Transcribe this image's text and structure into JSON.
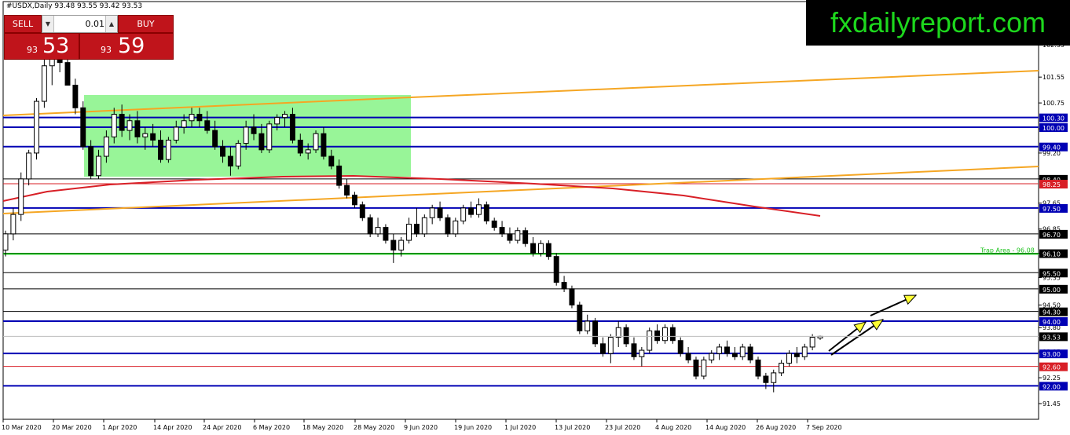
{
  "header": {
    "symbol_info": "#USDX,Daily  93.48 93.55 93.42 93.53"
  },
  "trade_panel": {
    "sell_label": "SELL",
    "buy_label": "BUY",
    "lot_value": "0.01",
    "sell_small": "93",
    "sell_big": "53",
    "buy_small": "93",
    "buy_big": "59"
  },
  "brand": "fxdailyreport.com",
  "colors": {
    "sell_red": "#c0141b",
    "brand_bg": "#000000",
    "brand_text": "#1dd81d",
    "zone_green": "#98f598",
    "ma_red": "#d81f26",
    "trend_orange": "#f5a623",
    "level_blue": "#0000b4"
  },
  "chart_data": {
    "type": "candlestick",
    "symbol": "#USDX",
    "timeframe": "Daily",
    "ylim": [
      91.45,
      102.55
    ],
    "x_labels": [
      "10 Mar 2020",
      "20 Mar 2020",
      "1 Apr 2020",
      "14 Apr 2020",
      "24 Apr 2020",
      "6 May 2020",
      "18 May 2020",
      "28 May 2020",
      "9 Jun 2020",
      "19 Jun 2020",
      "1 Jul 2020",
      "13 Jul 2020",
      "23 Jul 2020",
      "4 Aug 2020",
      "14 Aug 2020",
      "26 Aug 2020",
      "7 Sep 2020"
    ],
    "axis_ticks": [
      102.55,
      101.55,
      100.75,
      99.95,
      99.2,
      98.4,
      97.65,
      96.85,
      96.1,
      95.35,
      94.5,
      93.8,
      93.05,
      92.25,
      91.45
    ],
    "levels": [
      {
        "label": "100.30",
        "value": 100.3,
        "color": "#0000b4"
      },
      {
        "label": "100.00",
        "value": 100.0,
        "color": "#0000b4"
      },
      {
        "label": "99.40",
        "value": 99.4,
        "color": "#0000b4"
      },
      {
        "label": "98.40",
        "value": 98.4,
        "color": "#000000"
      },
      {
        "label": "98.25",
        "value": 98.25,
        "color": "#d81f26"
      },
      {
        "label": "97.50",
        "value": 97.5,
        "color": "#0000b4"
      },
      {
        "label": "96.70",
        "value": 96.7,
        "color": "#000000"
      },
      {
        "label": "96.10",
        "value": 96.1,
        "color": "#000000"
      },
      {
        "label": "95.50",
        "value": 95.5,
        "color": "#000000"
      },
      {
        "label": "95.00",
        "value": 95.0,
        "color": "#000000"
      },
      {
        "label": "94.30",
        "value": 94.3,
        "color": "#000000"
      },
      {
        "label": "94.00",
        "value": 94.0,
        "color": "#0000b4"
      },
      {
        "label": "93.00",
        "value": 93.0,
        "color": "#0000b4"
      },
      {
        "label": "92.60",
        "value": 92.6,
        "color": "#d81f26"
      },
      {
        "label": "92.00",
        "value": 92.0,
        "color": "#0000b4"
      }
    ],
    "current_price": {
      "label": "93.53",
      "value": 93.53
    },
    "trap_area": {
      "label": "Trap Area - 96.08",
      "value": 96.08
    },
    "candles": [
      [
        96.2,
        96.8,
        96.0,
        96.7
      ],
      [
        96.7,
        97.5,
        96.5,
        97.3
      ],
      [
        97.3,
        98.6,
        97.1,
        98.4
      ],
      [
        98.4,
        99.3,
        98.2,
        99.2
      ],
      [
        99.2,
        100.9,
        99.0,
        100.8
      ],
      [
        100.8,
        102.2,
        100.6,
        101.9
      ],
      [
        101.9,
        102.5,
        101.3,
        102.2
      ],
      [
        102.2,
        102.6,
        101.7,
        102.0
      ],
      [
        102.0,
        102.3,
        101.4,
        101.3
      ],
      [
        101.3,
        101.5,
        100.4,
        100.6
      ],
      [
        100.6,
        100.8,
        99.3,
        99.4
      ],
      [
        99.4,
        99.6,
        98.4,
        98.5
      ],
      [
        98.5,
        99.3,
        98.4,
        99.1
      ],
      [
        99.1,
        99.9,
        98.9,
        99.7
      ],
      [
        99.7,
        100.6,
        99.5,
        100.4
      ],
      [
        100.4,
        100.7,
        99.7,
        99.9
      ],
      [
        99.9,
        100.4,
        99.6,
        100.2
      ],
      [
        100.2,
        100.5,
        99.5,
        99.7
      ],
      [
        99.7,
        100.0,
        99.3,
        99.8
      ],
      [
        99.8,
        100.1,
        99.4,
        99.6
      ],
      [
        99.6,
        99.9,
        98.9,
        99.0
      ],
      [
        99.0,
        99.7,
        98.9,
        99.6
      ],
      [
        99.6,
        100.2,
        99.5,
        100.0
      ],
      [
        100.0,
        100.4,
        99.8,
        100.2
      ],
      [
        100.2,
        100.6,
        100.0,
        100.4
      ],
      [
        100.4,
        100.6,
        100.0,
        100.2
      ],
      [
        100.2,
        100.5,
        99.8,
        99.9
      ],
      [
        99.9,
        100.2,
        99.3,
        99.4
      ],
      [
        99.4,
        99.6,
        98.9,
        99.1
      ],
      [
        99.1,
        99.4,
        98.5,
        98.8
      ],
      [
        98.8,
        99.6,
        98.7,
        99.5
      ],
      [
        99.5,
        100.2,
        99.3,
        100.0
      ],
      [
        100.0,
        100.4,
        99.6,
        99.8
      ],
      [
        99.8,
        100.1,
        99.2,
        99.3
      ],
      [
        99.3,
        100.2,
        99.2,
        100.1
      ],
      [
        100.1,
        100.4,
        99.9,
        100.3
      ],
      [
        100.3,
        100.5,
        100.0,
        100.4
      ],
      [
        100.4,
        100.6,
        99.5,
        99.6
      ],
      [
        99.6,
        99.8,
        99.1,
        99.2
      ],
      [
        99.2,
        99.5,
        99.0,
        99.3
      ],
      [
        99.3,
        99.9,
        99.2,
        99.8
      ],
      [
        99.8,
        100.0,
        99.0,
        99.1
      ],
      [
        99.1,
        99.3,
        98.7,
        98.8
      ],
      [
        98.8,
        99.0,
        98.1,
        98.2
      ],
      [
        98.2,
        98.4,
        97.8,
        97.9
      ],
      [
        97.9,
        98.0,
        97.5,
        97.6
      ],
      [
        97.6,
        97.7,
        97.1,
        97.2
      ],
      [
        97.2,
        97.3,
        96.6,
        96.7
      ],
      [
        96.7,
        97.2,
        96.6,
        96.9
      ],
      [
        96.9,
        97.0,
        96.4,
        96.5
      ],
      [
        96.5,
        96.7,
        95.8,
        96.2
      ],
      [
        96.2,
        96.6,
        96.0,
        96.5
      ],
      [
        96.5,
        97.2,
        96.4,
        97.0
      ],
      [
        97.0,
        97.5,
        96.6,
        96.7
      ],
      [
        96.7,
        97.3,
        96.6,
        97.2
      ],
      [
        97.2,
        97.6,
        97.0,
        97.5
      ],
      [
        97.5,
        97.7,
        97.1,
        97.2
      ],
      [
        97.2,
        97.3,
        96.6,
        96.7
      ],
      [
        96.7,
        97.2,
        96.6,
        97.1
      ],
      [
        97.1,
        97.6,
        97.0,
        97.5
      ],
      [
        97.5,
        97.7,
        97.2,
        97.3
      ],
      [
        97.3,
        97.8,
        97.2,
        97.6
      ],
      [
        97.6,
        97.7,
        97.0,
        97.1
      ],
      [
        97.1,
        97.2,
        96.8,
        96.9
      ],
      [
        96.9,
        97.1,
        96.6,
        96.7
      ],
      [
        96.7,
        96.9,
        96.4,
        96.5
      ],
      [
        96.5,
        96.9,
        96.4,
        96.8
      ],
      [
        96.8,
        96.9,
        96.3,
        96.4
      ],
      [
        96.4,
        96.6,
        96.0,
        96.1
      ],
      [
        96.1,
        96.5,
        96.0,
        96.4
      ],
      [
        96.4,
        96.5,
        95.9,
        96.0
      ],
      [
        96.0,
        96.1,
        95.1,
        95.2
      ],
      [
        95.2,
        95.4,
        94.9,
        95.0
      ],
      [
        95.0,
        95.1,
        94.4,
        94.5
      ],
      [
        94.5,
        94.6,
        93.6,
        93.7
      ],
      [
        93.7,
        94.2,
        93.6,
        94.0
      ],
      [
        94.0,
        94.1,
        93.2,
        93.3
      ],
      [
        93.3,
        93.5,
        92.9,
        93.0
      ],
      [
        93.0,
        93.6,
        92.7,
        93.5
      ],
      [
        93.5,
        94.0,
        93.2,
        93.8
      ],
      [
        93.8,
        93.9,
        93.2,
        93.3
      ],
      [
        93.3,
        93.5,
        92.8,
        92.9
      ],
      [
        92.9,
        93.2,
        92.6,
        93.1
      ],
      [
        93.1,
        93.8,
        93.0,
        93.7
      ],
      [
        93.7,
        93.9,
        93.3,
        93.4
      ],
      [
        93.4,
        93.9,
        93.3,
        93.8
      ],
      [
        93.8,
        93.9,
        93.3,
        93.4
      ],
      [
        93.4,
        93.5,
        92.9,
        93.0
      ],
      [
        93.0,
        93.2,
        92.7,
        92.8
      ],
      [
        92.8,
        92.9,
        92.2,
        92.3
      ],
      [
        92.3,
        92.9,
        92.2,
        92.8
      ],
      [
        92.8,
        93.1,
        92.7,
        93.0
      ],
      [
        93.0,
        93.3,
        92.8,
        93.2
      ],
      [
        93.2,
        93.4,
        92.9,
        93.0
      ],
      [
        93.0,
        93.2,
        92.8,
        92.9
      ],
      [
        92.9,
        93.3,
        92.8,
        93.2
      ],
      [
        93.2,
        93.3,
        92.7,
        92.8
      ],
      [
        92.8,
        92.9,
        92.2,
        92.3
      ],
      [
        92.3,
        92.4,
        91.9,
        92.1
      ],
      [
        92.1,
        92.5,
        91.8,
        92.4
      ],
      [
        92.4,
        92.8,
        92.3,
        92.7
      ],
      [
        92.7,
        93.1,
        92.6,
        93.0
      ],
      [
        93.0,
        93.2,
        92.7,
        92.9
      ],
      [
        92.9,
        93.3,
        92.8,
        93.2
      ],
      [
        93.2,
        93.6,
        93.1,
        93.5
      ],
      [
        93.48,
        93.55,
        93.42,
        93.53
      ]
    ]
  }
}
